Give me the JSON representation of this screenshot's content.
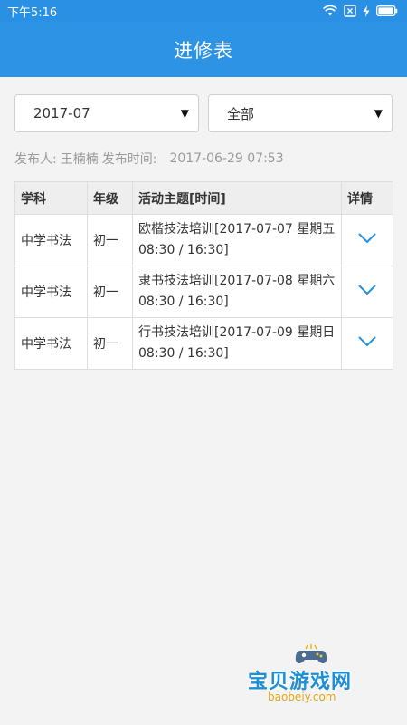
{
  "status_bar": {
    "time": "下午5:16"
  },
  "header": {
    "title": "进修表"
  },
  "filters": {
    "month": {
      "value": "2017-07",
      "arrow": "▼"
    },
    "category": {
      "value": "全部",
      "arrow": "▼"
    }
  },
  "meta": {
    "publisher_label": "发布人:",
    "publisher": "王楠楠",
    "time_label": "发布时间:",
    "time": "2017-06-29 07:53"
  },
  "table": {
    "headers": {
      "subject": "学科",
      "grade": "年级",
      "topic": "活动主题[时间]",
      "detail": "详情"
    },
    "rows": [
      {
        "subject": "中学书法",
        "grade": "初一",
        "topic": "欧楷技法培训[2017-07-07 星期五 08:30 / 16:30]"
      },
      {
        "subject": "中学书法",
        "grade": "初一",
        "topic": "隶书技法培训[2017-07-08 星期六 08:30 / 16:30]"
      },
      {
        "subject": "中学书法",
        "grade": "初一",
        "topic": "行书技法培训[2017-07-09 星期日 08:30 / 16:30]"
      }
    ]
  },
  "watermark": {
    "title": "宝贝游戏网",
    "url": "baobeiy.com"
  },
  "colors": {
    "accent": "#2d93e5",
    "chevron": "#2a8fd8"
  }
}
